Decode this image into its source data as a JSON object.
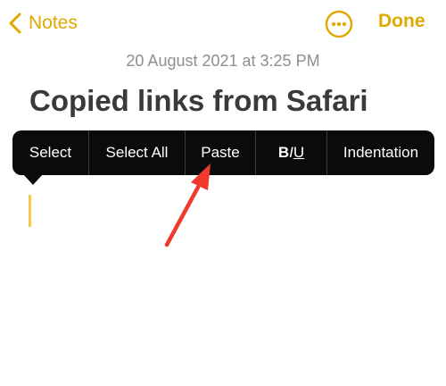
{
  "nav": {
    "back_label": "Notes",
    "done_label": "Done",
    "more_icon": "ellipsis-circle-icon",
    "back_icon": "chevron-left-icon"
  },
  "note": {
    "date": "20 August 2021 at 3:25 PM",
    "title": "Copied links from Safari"
  },
  "edit_menu": {
    "items": [
      "Select",
      "Select All",
      "Paste",
      "Indentation"
    ],
    "format": {
      "bold": "B",
      "italic": "I",
      "underline": "U"
    }
  },
  "colors": {
    "accent": "#e0a800",
    "menu_bg": "#0b0b0b",
    "title": "#3a3a3c",
    "date": "#8e8e93",
    "cursor": "#f2c94c",
    "annotation_arrow": "#f03a2e"
  }
}
